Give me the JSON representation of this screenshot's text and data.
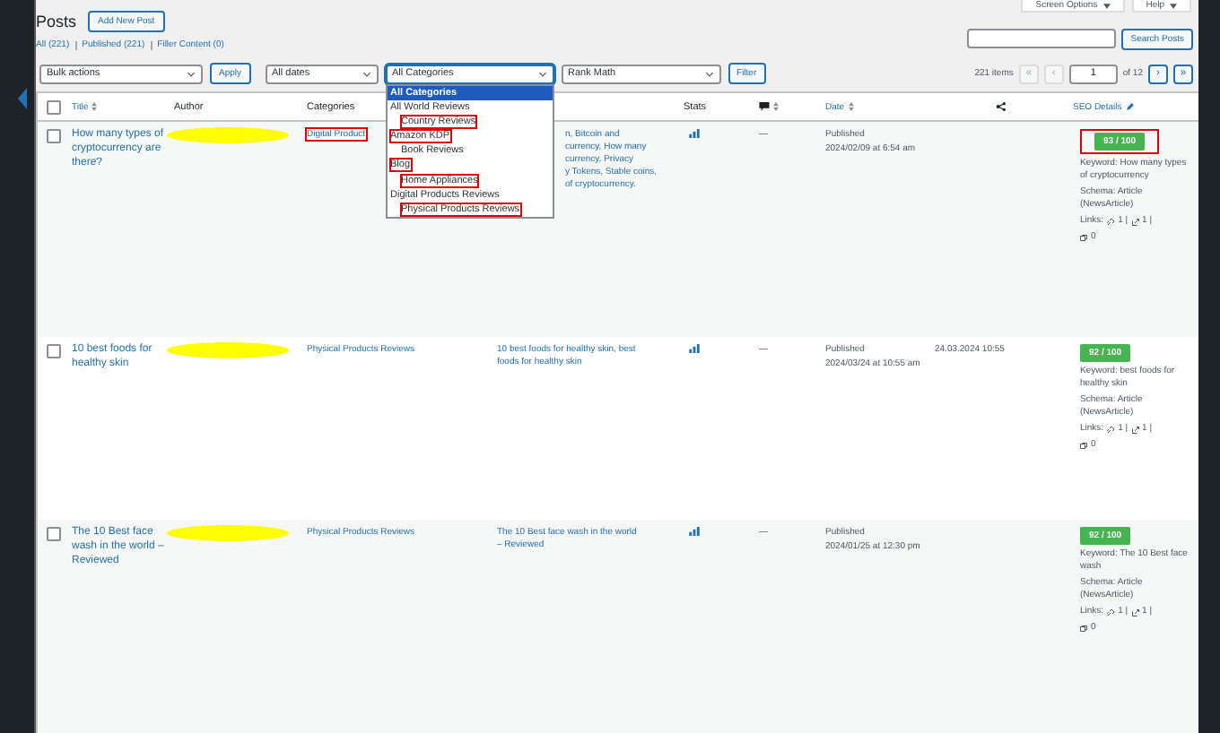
{
  "screen_meta": [
    {
      "label": "Screen Options"
    },
    {
      "label": "Help"
    }
  ],
  "page": {
    "title": "Posts",
    "add_new": "Add New Post"
  },
  "status_links": [
    {
      "label": "All (221)"
    },
    {
      "label": "Published (221)"
    },
    {
      "label": "Filler Content (0)"
    }
  ],
  "search": {
    "button": "Search Posts"
  },
  "filters": {
    "bulk": "Bulk actions",
    "apply": "Apply",
    "dates": "All dates",
    "categories": "All Categories",
    "seo": "Rank Math",
    "filter": "Filter"
  },
  "category_menu": [
    {
      "label": "All Categories",
      "selected": true,
      "marked": false
    },
    {
      "label": "All World Reviews",
      "selected": false,
      "marked": false,
      "children": [
        {
          "label": "Country Reviews",
          "selected": false,
          "marked": true
        }
      ]
    },
    {
      "label": "Amazon KDP",
      "selected": false,
      "marked": true,
      "children": [
        {
          "label": "Book Reviews",
          "selected": false,
          "marked": false
        }
      ]
    },
    {
      "label": "Blog",
      "selected": false,
      "marked": true,
      "children": [
        {
          "label": "Home Appliances",
          "selected": false,
          "marked": true
        }
      ]
    },
    {
      "label": "Digital Products Reviews",
      "selected": false,
      "marked": false,
      "children": [
        {
          "label": "Physical Products Reviews",
          "selected": false,
          "marked": true
        }
      ]
    }
  ],
  "pagination": {
    "count": "221 items",
    "first": {
      "label": "«",
      "disabled": true
    },
    "prev": {
      "label": "‹",
      "disabled": true
    },
    "page": "1",
    "of": "of 12",
    "next": {
      "label": "›",
      "disabled": false
    },
    "last": {
      "label": "»",
      "disabled": false
    }
  },
  "select_all": {
    "checked": false
  },
  "columns": {
    "title": "Title",
    "author": "Author",
    "categories": "Categories",
    "stats": "Stats",
    "date": "Date",
    "seo": "SEO Details"
  },
  "rows": [
    {
      "checked": false,
      "title": "How many types of cryptocurrency are there?",
      "category": "Digital Product",
      "category_marked": true,
      "column_4": [
        "n, Bitcoin and",
        "currency, How many",
        "currency, Privacy",
        "y Tokens, Stable coins,",
        "of cryptocurrency."
      ],
      "column_4_covered": true,
      "comments": "—",
      "status": "Published",
      "date": "2024/02/09 at 6:54 am",
      "score": "93 / 100",
      "score_marked": true,
      "keyword": "Keyword: How many types of cryptocurrency",
      "schema": "Schema: Article (NewsArticle)",
      "links": {
        "label": "Links:",
        "internal": "1 |",
        "external": "1 |",
        "incoming": "0"
      }
    },
    {
      "checked": false,
      "title": "10 best foods for healthy skin",
      "category": "Physical Products Reviews",
      "category_marked": false,
      "column_4": [
        "10 best foods for healthy skin, best",
        "foods for healthy skin"
      ],
      "column_4_covered": false,
      "comments": "—",
      "status": "Published",
      "date": "2024/03/24 at 10:55 am",
      "modified": "24.03.2024 10:55",
      "score": "92 / 100",
      "score_marked": false,
      "keyword": "Keyword: best foods for healthy skin",
      "schema": "Schema: Article (NewsArticle)",
      "links": {
        "label": "Links:",
        "internal": "1 |",
        "external": "1 |",
        "incoming": "0"
      }
    },
    {
      "checked": false,
      "title": "The 10 Best face wash in the world – Reviewed",
      "category": "Physical Products Reviews",
      "category_marked": false,
      "column_4": [
        "The 10 Best face wash in the world",
        "– Reviewed"
      ],
      "column_4_covered": false,
      "comments": "—",
      "status": "Published",
      "date": "2024/01/25 at 12:30 pm",
      "score": "92 / 100",
      "score_marked": false,
      "keyword": "Keyword: The 10 Best face wash",
      "schema": "Schema: Article (NewsArticle)",
      "links": {
        "label": "Links:",
        "internal": "1 |",
        "external": "1 |",
        "incoming": "0"
      }
    }
  ]
}
